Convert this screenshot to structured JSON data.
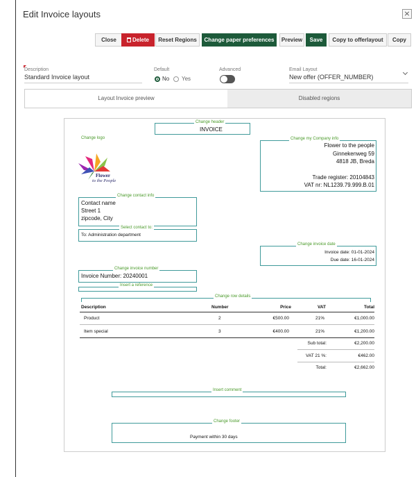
{
  "dialog": {
    "title": "Edit Invoice layouts",
    "close_icon": "×"
  },
  "toolbar": {
    "close": "Close",
    "delete": "Delete",
    "reset_regions": "Reset Regions",
    "change_paper": "Change paper preferences",
    "preview": "Preview",
    "save": "Save",
    "copy_to_offer": "Copy to offerlayout",
    "copy": "Copy"
  },
  "form": {
    "description_label": "Description",
    "description_value": "Standard Invoice layout",
    "default_label": "Default",
    "default_no": "No",
    "default_yes": "Yes",
    "default_selected": "No",
    "advanced_label": "Advanced",
    "advanced_on": false,
    "email_label": "Email Layout",
    "email_value": "New offer (OFFER_NUMBER)"
  },
  "tabs": {
    "preview": "Layout Invoice preview",
    "disabled": "Disabled regions",
    "active": "preview"
  },
  "invoice": {
    "header_label": "Change header",
    "header_title": "INVOICE",
    "logo_label": "Change logo",
    "logo_text1": "Flower",
    "logo_text2": "to the People",
    "company_label": "Change my Company info",
    "company_name": "Flower to the people",
    "company_street": "Ginnekenweg 59",
    "company_city": "4818 JB, Breda",
    "company_register": "Trade register: 20104843",
    "company_vat": "VAT nr: NL1239.79.999.B.01",
    "contact_label": "Change contact info",
    "contact_name": "Contact name",
    "contact_street": "Street 1",
    "contact_city": "zipcode, City",
    "select_contact_label": "Select contact to:",
    "select_contact_value": "To: Administration department",
    "invoice_date_label": "Change invoice date",
    "invoice_date": "Invoice date: 01-01-2024",
    "due_date": "Due date: 16-01-2024",
    "invoice_number_label": "Change invoice number",
    "invoice_number": "Invoice Number: 20240001",
    "reference_label": "Insert a reference",
    "row_details_label": "Change row details",
    "columns": [
      "Description",
      "Number",
      "Price",
      "VAT",
      "Total"
    ],
    "rows": [
      [
        "Product",
        "2",
        "€500.00",
        "21%",
        "€1,000.00"
      ],
      [
        "Item special",
        "3",
        "€400.00",
        "21%",
        "€1,200.00"
      ]
    ],
    "subtotal_label": "Sub total:",
    "subtotal_value": "€2,200.00",
    "vat_label": "VAT 21 %:",
    "vat_value": "€462.00",
    "total_label": "Total:",
    "total_value": "€2,662.00",
    "comment_label": "Insert comment",
    "footer_label": "Change footer",
    "footer_text": "Payment within 30 days"
  },
  "colors": {
    "delete_red": "#c8232c",
    "save_green": "#1d5a3a",
    "region_teal": "#3f9a9a",
    "region_label_green": "#4a9a2a"
  }
}
